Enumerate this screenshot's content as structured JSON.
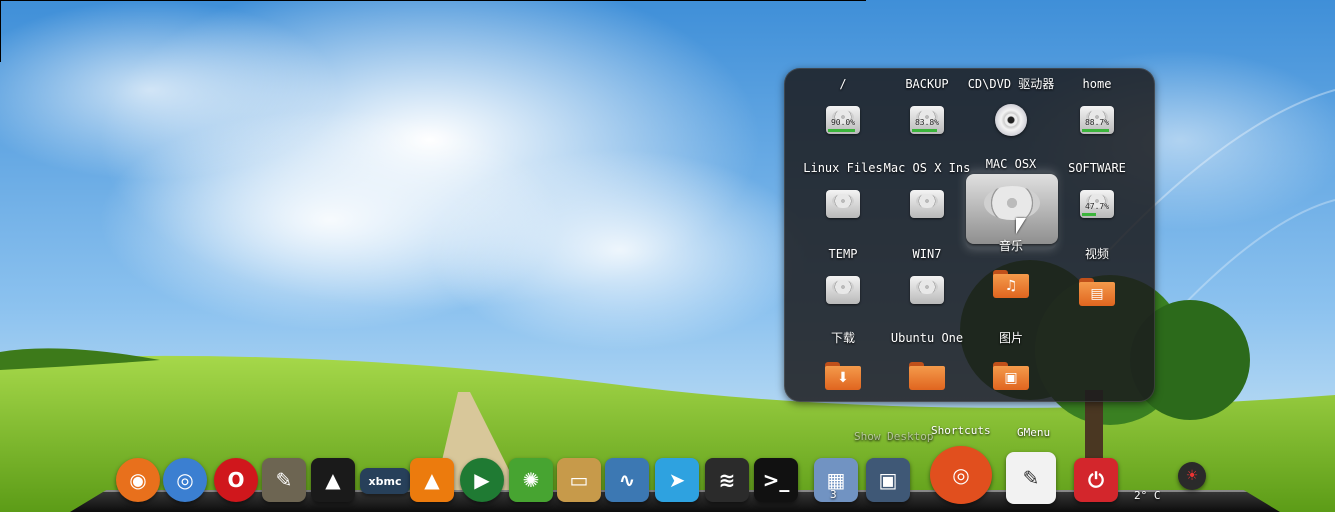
{
  "desktop": {
    "sky_top": "#3f8fd8",
    "grass": "#86c92c"
  },
  "stack": {
    "items": [
      {
        "label": "/",
        "icon": "hard-drive-icon",
        "usage": "90.0%",
        "fill": 0.9
      },
      {
        "label": "BACKUP",
        "icon": "hard-drive-icon",
        "usage": "83.8%",
        "fill": 0.84
      },
      {
        "label": "CD\\DVD 驱动器",
        "icon": "cd-dvd-icon"
      },
      {
        "label": "home",
        "icon": "hard-drive-icon",
        "usage": "88.7%",
        "fill": 0.89
      },
      {
        "label": "Linux Files",
        "icon": "hard-drive-icon"
      },
      {
        "label": "Mac OS X Ins",
        "icon": "hard-drive-icon"
      },
      {
        "label": "MAC OSX",
        "icon": "hard-drive-icon"
      },
      {
        "label": "SOFTWARE",
        "icon": "hard-drive-icon",
        "usage": "47.7%",
        "fill": 0.48
      },
      {
        "label": "TEMP",
        "icon": "hard-drive-icon"
      },
      {
        "label": "WIN7",
        "icon": "hard-drive-icon"
      },
      {
        "label": "音乐",
        "icon": "music-folder-icon",
        "glyph": "♫"
      },
      {
        "label": "视频",
        "icon": "video-folder-icon",
        "glyph": "▤"
      },
      {
        "label": "下载",
        "icon": "download-folder-icon",
        "glyph": "⬇"
      },
      {
        "label": "Ubuntu One",
        "icon": "folder-icon",
        "glyph": ""
      },
      {
        "label": "图片",
        "icon": "pictures-folder-icon",
        "glyph": "▣"
      }
    ]
  },
  "dock": {
    "show_desktop_label": "Show Desktop",
    "shortcuts_label": "Shortcuts",
    "gmenu_label": "GMenu",
    "workspace_count": "3",
    "temperature": "2° C",
    "apps": [
      {
        "name": "firefox-icon",
        "color": "#e8701c",
        "glyph": "◉"
      },
      {
        "name": "chromium-icon",
        "color": "#3b7fd1",
        "glyph": "◎"
      },
      {
        "name": "opera-icon",
        "color": "#d0171c",
        "glyph": "O"
      },
      {
        "name": "gimp-icon",
        "color": "#6d6552",
        "glyph": "✎"
      },
      {
        "name": "inkscape-icon",
        "color": "#1a1a1a",
        "glyph": "▲"
      },
      {
        "name": "xbmc-icon",
        "color": "#27405a",
        "glyph": "xbmc"
      },
      {
        "name": "vlc-icon",
        "color": "#ec7b0d",
        "glyph": "▲"
      },
      {
        "name": "media-player-icon",
        "color": "#1f7a33",
        "glyph": "▶"
      },
      {
        "name": "settings-icon",
        "color": "#47a431",
        "glyph": "✺"
      },
      {
        "name": "book-reader-icon",
        "color": "#c79a4a",
        "glyph": "▭"
      },
      {
        "name": "system-monitor-icon",
        "color": "#3c78b3",
        "glyph": "∿"
      },
      {
        "name": "pointer-app-icon",
        "color": "#2ea2e0",
        "glyph": "➤"
      },
      {
        "name": "swirl-app-icon",
        "color": "#2b2b2b",
        "glyph": "≋"
      },
      {
        "name": "terminal-icon",
        "color": "#111111",
        "glyph": ">_"
      },
      {
        "name": "workspace-switcher-icon",
        "color": "#7193c2",
        "glyph": "▦"
      },
      {
        "name": "show-desktop-icon",
        "color": "#3f5876",
        "glyph": "▣"
      },
      {
        "name": "ubuntu-logo-icon",
        "color": "#e14f1e",
        "glyph": "◎"
      },
      {
        "name": "gmenu-icon",
        "color": "#f2f2f2",
        "glyph": "✎"
      },
      {
        "name": "power-icon",
        "color": "#d3262c",
        "glyph": "⏻"
      },
      {
        "name": "weather-icon",
        "color": "#2a2a2a",
        "glyph": "☀"
      }
    ]
  }
}
